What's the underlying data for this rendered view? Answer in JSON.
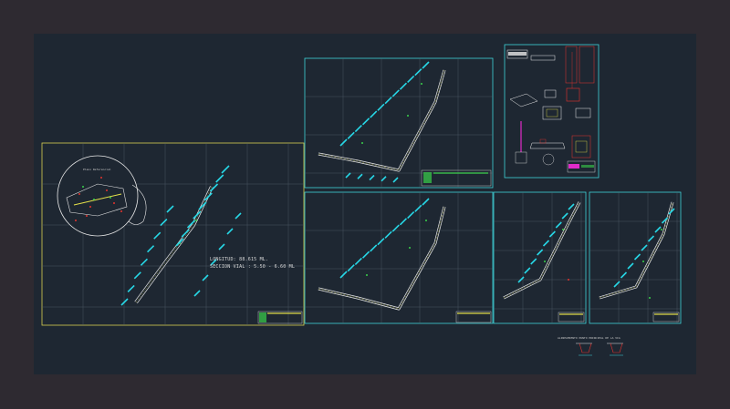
{
  "app": {
    "bg_color": "#2e2a31",
    "canvas_color": "#1e2732"
  },
  "colors": {
    "frame_yellow": "#d6cf52",
    "frame_cyan": "#3fd3d8",
    "grid": "#5a6674",
    "road": "#e8e8e8",
    "cyan_mark": "#27d7e6",
    "green": "#39d24a",
    "red": "#e8332e",
    "magenta": "#e02bc8",
    "yellow": "#e6e24a"
  },
  "sheet1": {
    "note_line1": "LONGITUD: 88.615 ML.",
    "note_line2": "SECCION VIAL : 5.50 - 6.60 ML",
    "detail_label": "Plano Referencial"
  },
  "bottom_note": "ALINEAMIENTO PUNTO PRINCIPAL DE LA VIA",
  "icons": {
    "north_arrow": "north-arrow-icon",
    "title_block": "title-block-icon"
  }
}
